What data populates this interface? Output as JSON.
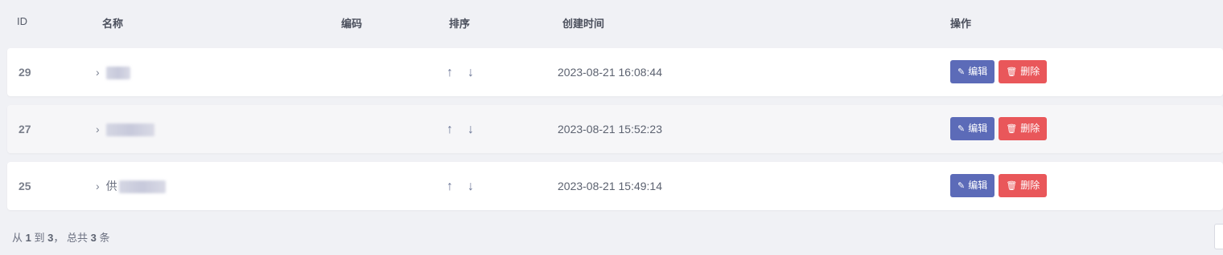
{
  "headers": {
    "id": "ID",
    "name": "名称",
    "code": "编码",
    "sort": "排序",
    "created": "创建时间",
    "actions": "操作"
  },
  "rows": [
    {
      "id": "29",
      "name_prefix": "",
      "created": "2023-08-21 16:08:44"
    },
    {
      "id": "27",
      "name_prefix": "",
      "created": "2023-08-21 15:52:23"
    },
    {
      "id": "25",
      "name_prefix": "供",
      "created": "2023-08-21 15:49:14"
    }
  ],
  "buttons": {
    "edit": "编辑",
    "delete": "删除"
  },
  "icons": {
    "expand": "chevron-right-icon",
    "up": "arrow-up-icon",
    "down": "arrow-down-icon",
    "edit": "edit-icon",
    "delete": "trash-icon"
  },
  "footer": {
    "from_label": "从",
    "start": "1",
    "to_label": "到",
    "end": "3",
    "total_label": "， 总共",
    "total": "3",
    "unit": "条"
  },
  "colors": {
    "edit_button": "#5c6bb8",
    "delete_button": "#e9575a",
    "background": "#f0f1f5"
  }
}
